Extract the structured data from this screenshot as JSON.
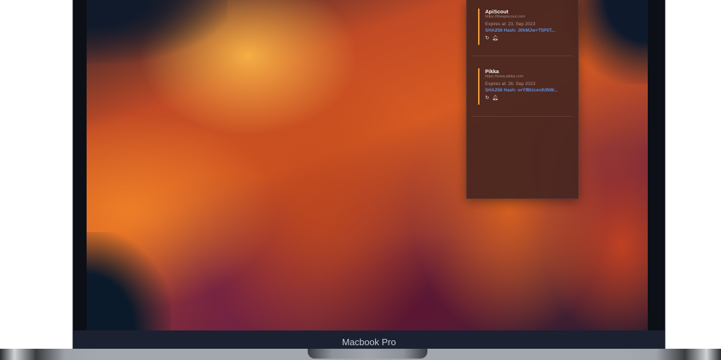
{
  "device": {
    "label": "Macbook Pro"
  },
  "panel": {
    "items": [
      {
        "name": "ApiScout",
        "url": "https://theapiscout.com",
        "expires": "Expires at: 23. Sep 2023",
        "hash": "SHA256 Hash: J0hMJw+T5P5T...",
        "icons": [
          "refresh-icon",
          "bell-icon"
        ]
      },
      {
        "name": "Pikka",
        "url": "https://www.pikka.com",
        "expires": "Expires at: 26. Sep 2023",
        "hash": "SHA256 Hash: orYfBUcerdUNW...",
        "icons": [
          "refresh-icon",
          "bell-icon"
        ]
      }
    ]
  },
  "colors": {
    "accent": "#f0a040",
    "link": "#5d8fe0"
  }
}
